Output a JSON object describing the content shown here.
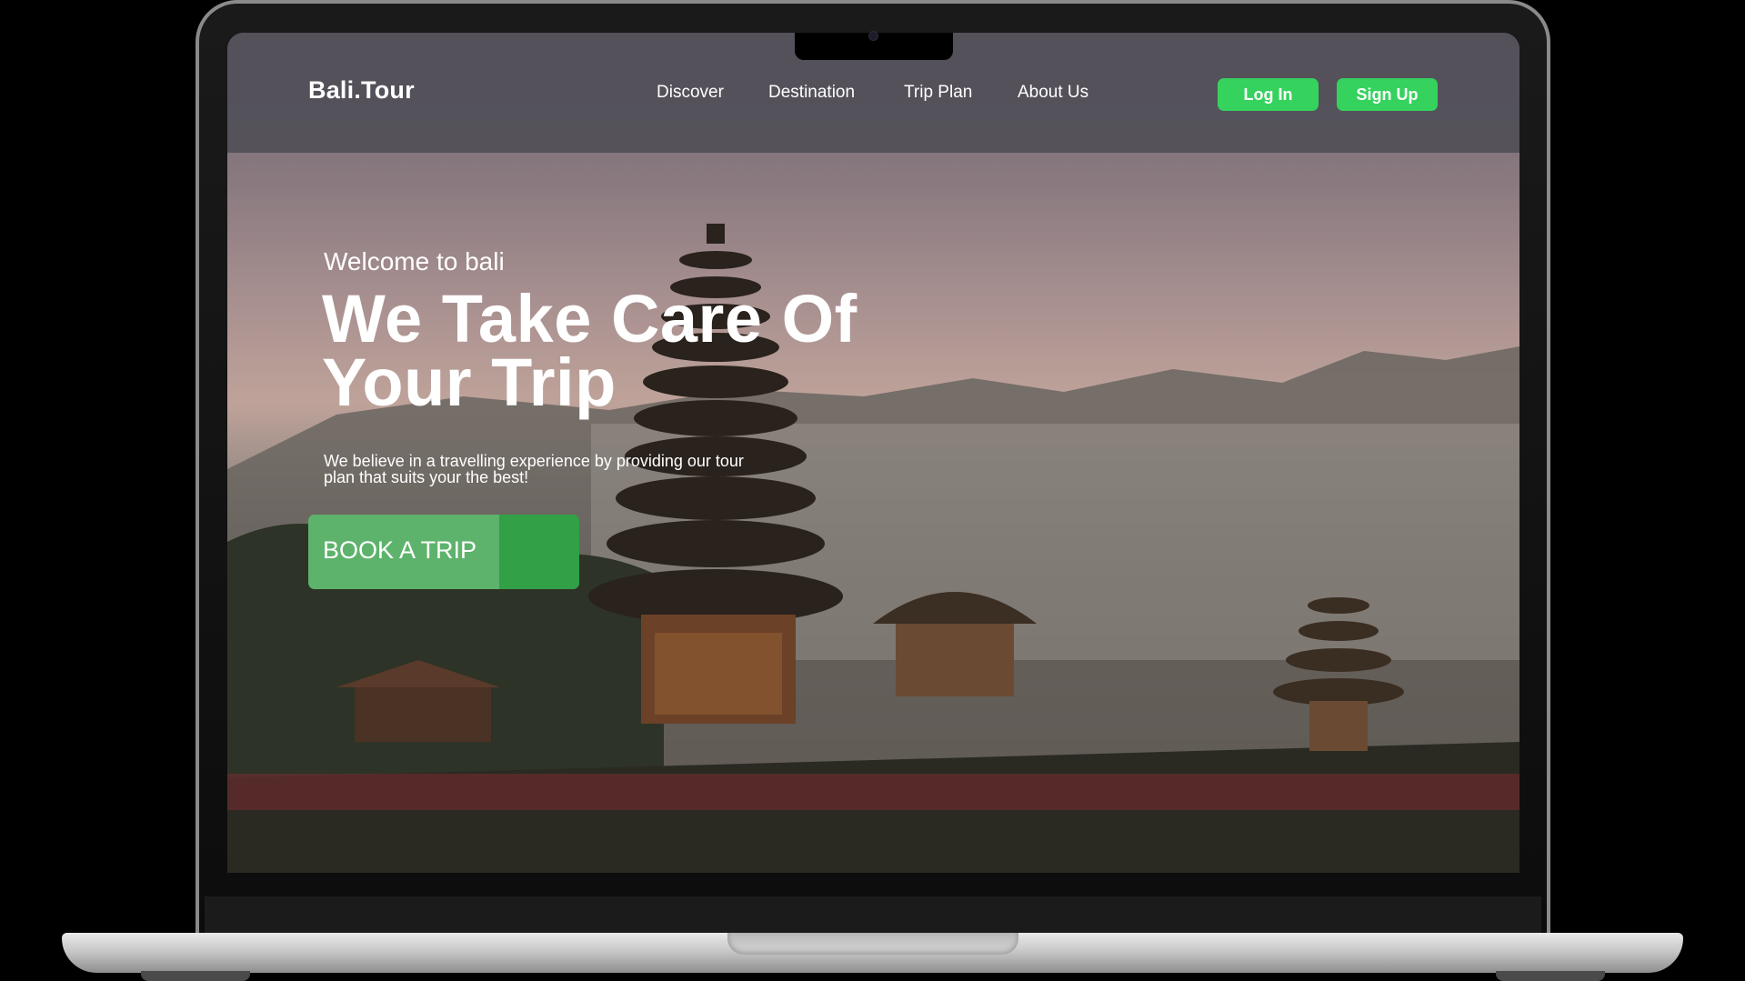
{
  "site": {
    "logo": "Bali.Tour"
  },
  "nav": {
    "items": [
      {
        "label": "Discover"
      },
      {
        "label": "Destination"
      },
      {
        "label": "Trip Plan"
      },
      {
        "label": "About Us"
      }
    ],
    "login_label": "Log In",
    "signup_label": "Sign Up"
  },
  "hero": {
    "welcome": "Welcome to bali",
    "headline": "We Take Care Of Your Trip",
    "subtitle": "We believe in a travelling experience by providing our tour plan that suits your the best!",
    "cta_label": "BOOK A TRIP"
  },
  "colors": {
    "accent_green": "#35d25e",
    "cta_green": "#5eb36c",
    "cta_dark_green": "#31a047",
    "navbar_bg": "#525058"
  }
}
